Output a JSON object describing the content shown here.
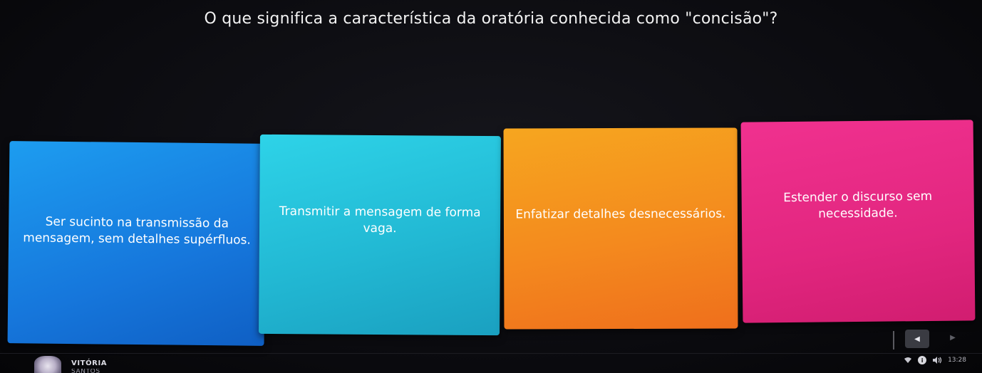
{
  "question": {
    "text": "O que significa a característica da oratória conhecida como \"concisão\"?"
  },
  "answers": [
    {
      "text": "Ser sucinto na transmissão da mensagem, sem detalhes supérfluos.",
      "color": "#1677dc"
    },
    {
      "text": "Transmitir a mensagem de forma vaga.",
      "color": "#22b9d4"
    },
    {
      "text": "Enfatizar detalhes desnecessários.",
      "color": "#f48a1e"
    },
    {
      "text": "Estender o discurso sem necessidade.",
      "color": "#e2267f"
    }
  ],
  "navigation": {
    "prev_icon": "◀",
    "next_icon": "▶"
  },
  "player": {
    "name": "VITÓRIA",
    "surname": "SANTOS"
  },
  "status_bar": {
    "wifi_icon": "wifi-icon",
    "info_icon": "info-icon",
    "volume_icon": "volume-icon",
    "time": "13:28"
  }
}
